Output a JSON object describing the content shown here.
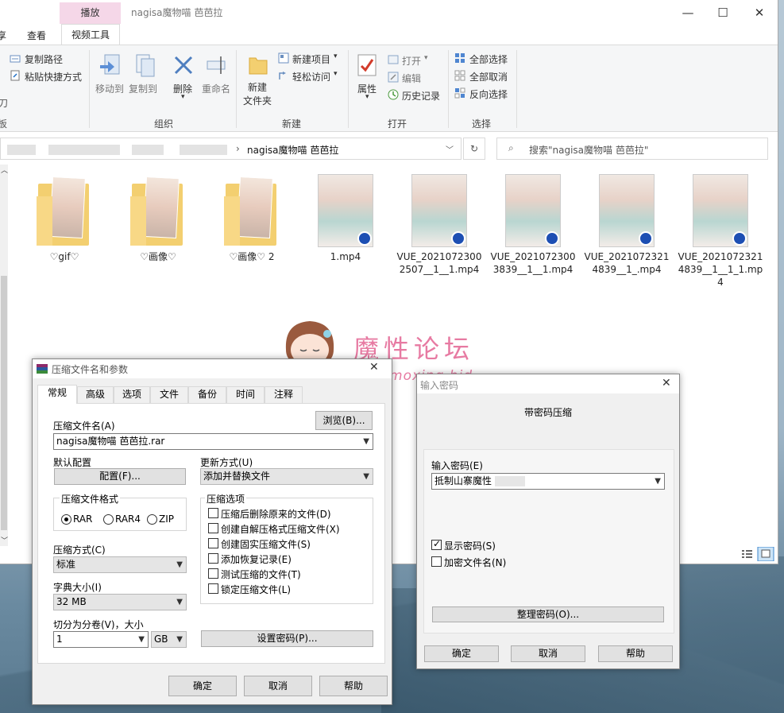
{
  "explorer": {
    "context_tab": "播放",
    "title": "nagisa魔物喵 芭芭拉",
    "ribbon_tabs": [
      "享",
      "查看",
      "视频工具"
    ],
    "clipboard": {
      "copy_path": "复制路径",
      "paste_shortcut": "粘贴快捷方式"
    },
    "organize": {
      "move_to": "移动到",
      "copy_to": "复制到",
      "delete": "删除",
      "rename": "重命名",
      "group": "组织"
    },
    "new": {
      "new_folder_line1": "新建",
      "new_folder_line2": "文件夹",
      "new_item": "新建项目",
      "easy_access": "轻松访问",
      "group": "新建"
    },
    "open": {
      "properties": "属性",
      "open": "打开",
      "edit": "编辑",
      "history": "历史记录",
      "group": "打开"
    },
    "select": {
      "select_all": "全部选择",
      "select_none": "全部取消",
      "invert": "反向选择",
      "group": "选择"
    },
    "address": {
      "current": "nagisa魔物喵 芭芭拉"
    },
    "search": {
      "placeholder": "搜索\"nagisa魔物喵 芭芭拉\""
    },
    "files": [
      {
        "name": "♡gif♡",
        "kind": "folder"
      },
      {
        "name": "♡画像♡",
        "kind": "folder"
      },
      {
        "name": "♡画像♡ 2",
        "kind": "folder"
      },
      {
        "name": "1.mp4",
        "kind": "video"
      },
      {
        "name": "VUE_20210723002507__1__1.mp4",
        "kind": "video"
      },
      {
        "name": "VUE_20210723003839__1__1.mp4",
        "kind": "video"
      },
      {
        "name": "VUE_20210723214839__1_.mp4",
        "kind": "video"
      },
      {
        "name": "VUE_20210723214839__1__1_1.mp4",
        "kind": "video"
      }
    ]
  },
  "watermark": {
    "title": "魔性论坛",
    "url": "www.moxing.bid"
  },
  "archive_dialog": {
    "title": "压缩文件名和参数",
    "tabs": [
      "常规",
      "高级",
      "选项",
      "文件",
      "备份",
      "时间",
      "注释"
    ],
    "archive_name_label": "压缩文件名(A)",
    "browse": "浏览(B)...",
    "archive_name_value": "nagisa魔物喵 芭芭拉.rar",
    "default_profile_label": "默认配置",
    "profile_button": "配置(F)...",
    "update_mode_label": "更新方式(U)",
    "update_mode_value": "添加并替换文件",
    "format_label": "压缩文件格式",
    "formats": [
      "RAR",
      "RAR4",
      "ZIP"
    ],
    "selected_format": "RAR",
    "options_label": "压缩选项",
    "options": [
      {
        "label": "压缩后删除原来的文件(D)",
        "checked": false
      },
      {
        "label": "创建自解压格式压缩文件(X)",
        "checked": false
      },
      {
        "label": "创建固实压缩文件(S)",
        "checked": false
      },
      {
        "label": "添加恢复记录(E)",
        "checked": false
      },
      {
        "label": "测试压缩的文件(T)",
        "checked": false
      },
      {
        "label": "锁定压缩文件(L)",
        "checked": false
      }
    ],
    "method_label": "压缩方式(C)",
    "method_value": "标准",
    "dict_label": "字典大小(I)",
    "dict_value": "32 MB",
    "split_label": "切分为分卷(V)，大小",
    "split_value": "1",
    "split_unit": "GB",
    "set_password": "设置密码(P)...",
    "ok": "确定",
    "cancel": "取消",
    "help": "帮助"
  },
  "password_dialog": {
    "title": "输入密码",
    "header": "带密码压缩",
    "enter_label": "输入密码(E)",
    "password_value": "抵制山寨魔性",
    "show_password": "显示密码(S)",
    "show_password_checked": true,
    "encrypt_names": "加密文件名(N)",
    "encrypt_names_checked": false,
    "organize": "整理密码(O)...",
    "ok": "确定",
    "cancel": "取消",
    "help": "帮助"
  },
  "colors": {
    "accent": "#1f6fc5",
    "context_tab": "#f5d7e8",
    "watermark": "#e77aa2",
    "folder": "#f3cf70"
  }
}
